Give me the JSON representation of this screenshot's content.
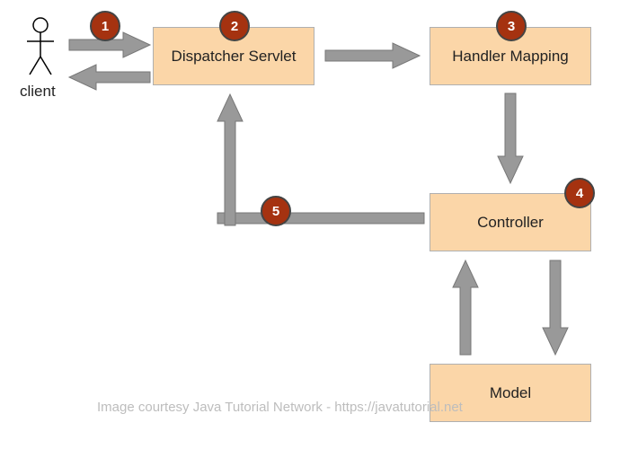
{
  "client_label": "client",
  "boxes": {
    "dispatcher": "Dispatcher Servlet",
    "handler": "Handler Mapping",
    "controller": "Controller",
    "model": "Model"
  },
  "badges": {
    "b1": "1",
    "b2": "2",
    "b3": "3",
    "b4": "4",
    "b5": "5"
  },
  "credit": "Image courtesy Java Tutorial Network - https://javatutorial.net"
}
